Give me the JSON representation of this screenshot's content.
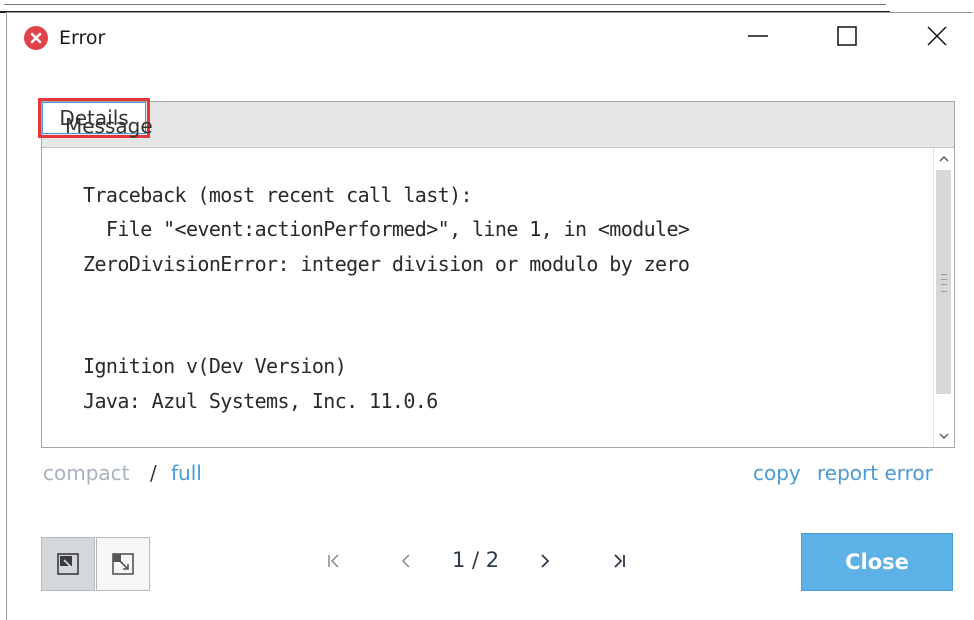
{
  "window": {
    "title": "Error",
    "icon": "error-icon",
    "controls": [
      "minimize-icon",
      "maximize-icon",
      "close-icon"
    ]
  },
  "tabs": {
    "message": "Message",
    "details": "Details",
    "selected": "Details",
    "highlight_color": "#e5363c"
  },
  "details": {
    "lines": [
      "Traceback (most recent call last):",
      "  File \"<event:actionPerformed>\", line 1, in <module>",
      "ZeroDivisionError: integer division or modulo by zero",
      "",
      "",
      "Ignition v(Dev Version)",
      "Java: Azul Systems, Inc. 11.0.6"
    ]
  },
  "view_links": {
    "compact": "compact",
    "separator": "/",
    "full": "full",
    "copy": "copy",
    "report_error": "report error"
  },
  "pager": {
    "count": "1 / 2",
    "icons": [
      "first-page-icon",
      "previous-page-icon",
      "next-page-icon",
      "last-page-icon"
    ]
  },
  "buttons": {
    "close": "Close",
    "close_color": "#5cb1e6"
  }
}
